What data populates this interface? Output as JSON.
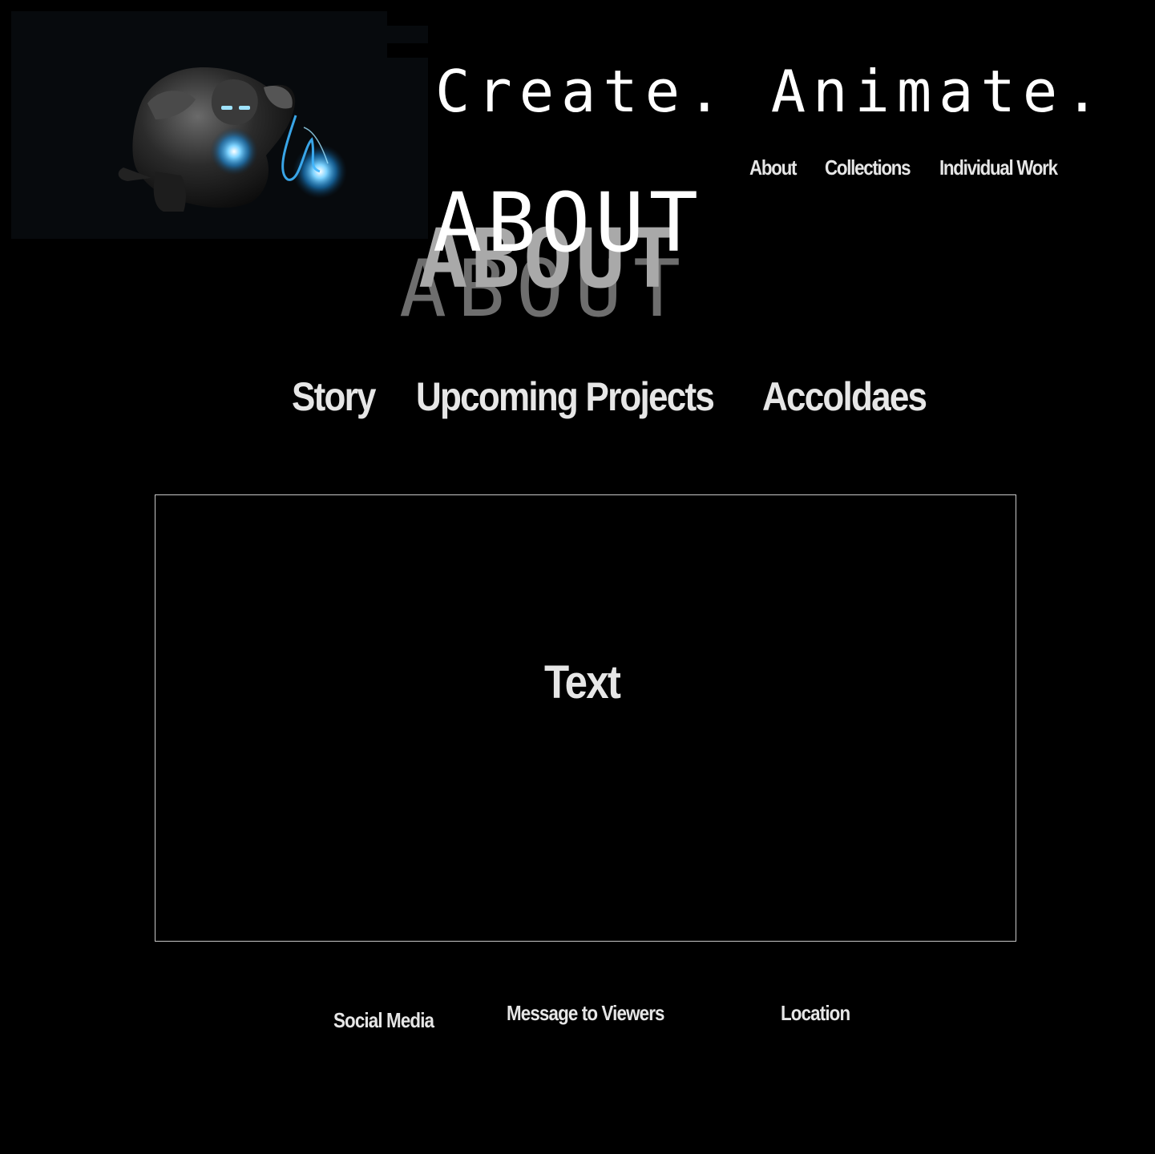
{
  "tagline": "Create. Animate.",
  "top_nav": {
    "about": "About",
    "collections": "Collections",
    "individual_work": "Individual Work"
  },
  "page_heading": "ABOUT",
  "sub_nav": {
    "story": "Story",
    "upcoming_projects": "Upcoming Projects",
    "accolades": "Accoldaes"
  },
  "content": {
    "text": "Text"
  },
  "footer": {
    "social_media": "Social Media",
    "message_to_viewers": "Message to Viewers",
    "location": "Location"
  },
  "colors": {
    "background": "#000000",
    "text": "#e6e6e6",
    "glow": "#3fb6ff"
  },
  "hero_image_icon": "armored-hero-figure-icon"
}
